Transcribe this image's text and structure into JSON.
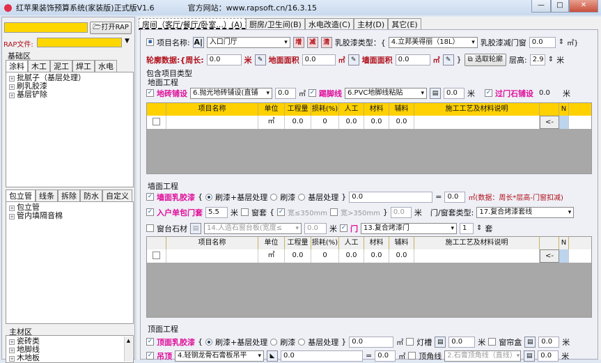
{
  "app": {
    "title": "红苹果装饰预算系统(家装版)正式版V1.6",
    "website": "官方网站：www.rapsoft.cn/16.3.15",
    "controls": [
      "—",
      "□",
      "✕"
    ]
  },
  "left": {
    "open_button": "打开RAP",
    "rap_label": "RAP文件:",
    "rap_value": "",
    "basic_label": "基础区",
    "tabs1": [
      "涂料",
      "木工",
      "泥工",
      "焊工",
      "水电"
    ],
    "tree1": [
      "批腻子（基层处理）",
      "刷乳胶漆",
      "基层铲除"
    ],
    "tabs2": [
      "包立管",
      "线条",
      "拆除",
      "防水",
      "自定义"
    ],
    "tree2": [
      "包立管",
      "管内填隔音棉"
    ],
    "main_label": "主材区",
    "tree3": [
      "瓷砖类",
      "地脚线",
      "木地板"
    ]
  },
  "tabs": [
    "房间（客厅/餐厅/卧室...）(A)",
    "厨房/卫生间(B)",
    "水电改造(C)",
    "主材(D)",
    "其它(E)"
  ],
  "form": {
    "project_name_label": "项目名称:",
    "project_name": "入口门厅",
    "add": "增",
    "del": "减",
    "clear": "清",
    "paint_type_label": "乳胶漆类型：{",
    "paint_type": "4.立邦美得丽（18L）",
    "paint_minus_label": "乳胶漆减门窗",
    "paint_minus": "0.0",
    "m2_close": "㎡}",
    "outline_label": "轮廓数据:{周长:",
    "perimeter": "0.0",
    "meter": "米",
    "floor_area_label": "地面面积",
    "floor_area": "0.0",
    "m2": "㎡",
    "wall_area_label": "墙面面积",
    "wall_area": "0.0",
    "brace": "}",
    "pick_outline": "选取轮廓",
    "floor_height_label": "层高:",
    "floor_height": "2.9",
    "include_label": "包含项目类型",
    "floor": {
      "title": "地面工程",
      "tile_label": "地砖铺设",
      "tile_type": "6.抛光地砖铺设(直铺",
      "tile_value": "0.0",
      "skirting_label": "踢脚线",
      "skirting_type": "6.PVC地脚线粘贴",
      "skirting_value": "0.0",
      "threshold_label": "过门石铺设",
      "threshold_value": "0.0"
    },
    "wall": {
      "title": "墙面工程",
      "paint_label": "墙面乳胶漆",
      "brace_open": "{",
      "opt1": "刷漆+基层处理",
      "opt2": "刷漆",
      "opt3": "基层处理",
      "brace_close": "}",
      "paint_value": "0.0",
      "equals": "=",
      "paint_result": "0.0",
      "note": "㎡(数据：周长*层高-门窗扣减)",
      "door_label": "入户单包门套",
      "door_value": "5.5",
      "window_cover": "窗套",
      "w_small": "宽≤350mm",
      "w_large": "宽>350mm",
      "cover_value": "0.0",
      "cover_type_label": "门/窗套类型:",
      "cover_type": "17.复合烤漆套线",
      "sill_label": "窗台石材",
      "sill_type": "14.人造石窗台板(宽度≤",
      "sill_value": "0.0",
      "door2_label": "门",
      "door2_type": "13.复合烤漆门",
      "door2_count": "1",
      "set": "套"
    },
    "ceiling": {
      "title": "顶面工程",
      "paint_label": "顶面乳胶漆",
      "paint_value": "0.0",
      "light_label": "灯槽",
      "light_value": "0.0",
      "curtain_label": "窗帘盒",
      "curtain_value": "0.0",
      "hang_label": "吊顶",
      "hang_type": "4.轻钢龙骨石膏板吊平",
      "hang_value": "0.0",
      "hang_result": "0.0",
      "corner_label": "顶角线",
      "corner_type": "2.石膏顶角线（直线）",
      "corner_value": "0.0"
    }
  },
  "grid": {
    "headers": [
      "",
      "项目名称",
      "单位",
      "工程量",
      "损耗(%)",
      "人工",
      "材料",
      "辅料",
      "施工工艺及材料说明",
      "",
      "N"
    ],
    "row": [
      "",
      "",
      "㎡",
      "0.0",
      "0",
      "0.0",
      "0.0",
      "0.0",
      "",
      "<-",
      ""
    ]
  }
}
